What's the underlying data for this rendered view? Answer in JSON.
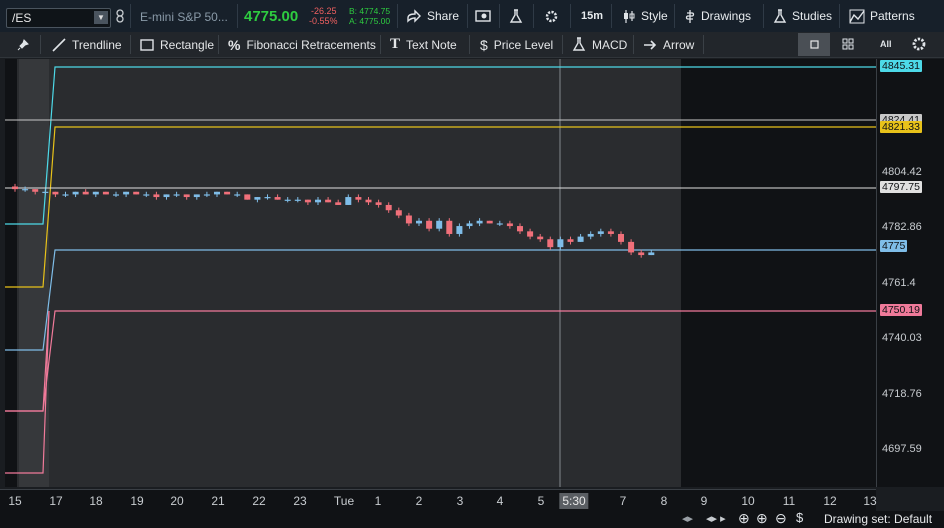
{
  "toolbar": {
    "symbol": "/ES",
    "instrument_name": "E-mini S&P 50...",
    "last_price": "4775.00",
    "change": "-26.25",
    "change_pct": "-0.55%",
    "bid": "B: 4774.75",
    "ask": "A: 4775.00",
    "share_label": "Share",
    "timeframe": "15m",
    "style_label": "Style",
    "drawings_label": "Drawings",
    "studies_label": "Studies",
    "patterns_label": "Patterns"
  },
  "drawing_tools": {
    "trendline": "Trendline",
    "rectangle": "Rectangle",
    "fibonacci": "Fibonacci Retracements",
    "text_note": "Text Note",
    "price_level": "Price Level",
    "macd": "MACD",
    "arrow": "Arrow",
    "all_label": "All"
  },
  "price_axis": {
    "ticks": [
      "4804.42",
      "4782.86",
      "4761.4",
      "4740.03",
      "4718.76",
      "4697.59"
    ]
  },
  "price_levels": [
    {
      "label": "4845.31",
      "color": "#4dd9e8"
    },
    {
      "label": "4824.41",
      "color": "#c8c8c8"
    },
    {
      "label": "4821.33",
      "color": "#e8c21a"
    },
    {
      "label": "4797.75",
      "color": "#e0e0e0"
    },
    {
      "label": "4775",
      "color": "#7fbde8"
    },
    {
      "label": "4750.19",
      "color": "#f07a9a"
    }
  ],
  "time_axis": {
    "ticks": [
      "15",
      "17",
      "18",
      "19",
      "20",
      "21",
      "22",
      "23",
      "Tue",
      "1",
      "2",
      "3",
      "4",
      "5",
      "5:30",
      "7",
      "8",
      "9",
      "10",
      "11",
      "12",
      "13"
    ],
    "cursor_label": "5:30"
  },
  "status": {
    "drawing_set": "Drawing set: Default"
  },
  "colors": {
    "up_candle": "#7fbde8",
    "down_candle": "#f0707a"
  },
  "chart_data": {
    "type": "candlestick",
    "ylim": [
      4690,
      4850
    ],
    "candles": [
      [
        4800,
        4801,
        4798,
        4799
      ],
      [
        4799,
        4800,
        4798,
        4799
      ],
      [
        4799,
        4799,
        4797,
        4798
      ],
      [
        4798,
        4799,
        4797,
        4798
      ],
      [
        4798,
        4798,
        4796,
        4797
      ],
      [
        4797,
        4798,
        4796,
        4797
      ],
      [
        4797,
        4798,
        4796,
        4798
      ],
      [
        4798,
        4799,
        4797,
        4797
      ],
      [
        4797,
        4798,
        4796,
        4798
      ],
      [
        4798,
        4798,
        4797,
        4797
      ],
      [
        4797,
        4798,
        4796,
        4797
      ],
      [
        4797,
        4798,
        4796,
        4798
      ],
      [
        4798,
        4798,
        4797,
        4797
      ],
      [
        4797,
        4798,
        4796,
        4797
      ],
      [
        4797,
        4798,
        4795,
        4796
      ],
      [
        4796,
        4797,
        4795,
        4797
      ],
      [
        4797,
        4798,
        4796,
        4797
      ],
      [
        4797,
        4797,
        4795,
        4796
      ],
      [
        4796,
        4797,
        4795,
        4797
      ],
      [
        4797,
        4798,
        4796,
        4797
      ],
      [
        4797,
        4798,
        4796,
        4798
      ],
      [
        4798,
        4798,
        4797,
        4797
      ],
      [
        4797,
        4798,
        4796,
        4797
      ],
      [
        4797,
        4797,
        4795,
        4795
      ],
      [
        4795,
        4796,
        4794,
        4796
      ],
      [
        4796,
        4797,
        4795,
        4796
      ],
      [
        4796,
        4797,
        4795,
        4795
      ],
      [
        4795,
        4796,
        4794,
        4795
      ],
      [
        4795,
        4796,
        4794,
        4795
      ],
      [
        4795,
        4795,
        4793,
        4794
      ],
      [
        4794,
        4796,
        4793,
        4795
      ],
      [
        4795,
        4796,
        4794,
        4794
      ],
      [
        4794,
        4795,
        4793,
        4793
      ],
      [
        4793,
        4797,
        4793,
        4796
      ],
      [
        4796,
        4797,
        4794,
        4795
      ],
      [
        4795,
        4796,
        4793,
        4794
      ],
      [
        4794,
        4795,
        4792,
        4793
      ],
      [
        4793,
        4794,
        4790,
        4791
      ],
      [
        4791,
        4792,
        4788,
        4789
      ],
      [
        4789,
        4790,
        4785,
        4786
      ],
      [
        4786,
        4788,
        4785,
        4787
      ],
      [
        4787,
        4788,
        4783,
        4784
      ],
      [
        4784,
        4788,
        4783,
        4787
      ],
      [
        4787,
        4788,
        4781,
        4782
      ],
      [
        4782,
        4786,
        4781,
        4785
      ],
      [
        4785,
        4787,
        4784,
        4786
      ],
      [
        4786,
        4788,
        4785,
        4787
      ],
      [
        4787,
        4787,
        4786,
        4786
      ],
      [
        4786,
        4787,
        4785,
        4786
      ],
      [
        4786,
        4787,
        4784,
        4785
      ],
      [
        4785,
        4786,
        4782,
        4783
      ],
      [
        4783,
        4784,
        4780,
        4781
      ],
      [
        4781,
        4782,
        4779,
        4780
      ],
      [
        4780,
        4781,
        4776,
        4777
      ],
      [
        4777,
        4781,
        4776,
        4780
      ],
      [
        4780,
        4781,
        4778,
        4779
      ],
      [
        4779,
        4782,
        4779,
        4781
      ],
      [
        4781,
        4783,
        4780,
        4782
      ],
      [
        4782,
        4784,
        4781,
        4783
      ],
      [
        4783,
        4784,
        4781,
        4782
      ],
      [
        4782,
        4783,
        4778,
        4779
      ],
      [
        4779,
        4780,
        4774,
        4775
      ],
      [
        4775,
        4776,
        4773,
        4774
      ],
      [
        4774,
        4776,
        4774,
        4775
      ]
    ]
  }
}
